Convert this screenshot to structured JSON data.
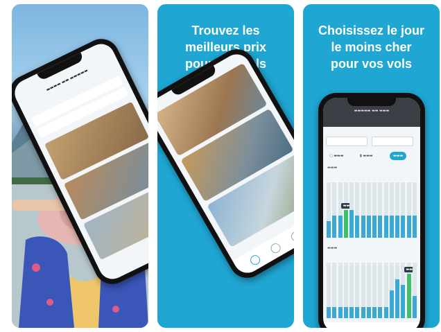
{
  "panel2": {
    "headline": [
      "Trouvez les",
      "meilleurs prix",
      "pour vos vols"
    ]
  },
  "panel3": {
    "headline": [
      "Choisissez le jour",
      "le moins cher",
      "pour vos vols"
    ]
  },
  "colors": {
    "panel_blue": "#1fa6d3",
    "bar_blue": "#3aa9d6",
    "bar_selected": "#3fbf6a",
    "phone_frame": "#111111"
  },
  "chart_data": [
    {
      "type": "bar",
      "title": "",
      "series": [
        {
          "values": [
            3,
            4,
            4,
            5,
            5,
            4,
            4,
            4,
            4,
            4,
            4,
            4,
            4,
            4,
            4,
            4
          ]
        }
      ],
      "selected_index": 3
    },
    {
      "type": "bar",
      "title": "",
      "series": [
        {
          "values": [
            2,
            2,
            2,
            2,
            2,
            2,
            2,
            2,
            2,
            2,
            2,
            5,
            7,
            6,
            8,
            4
          ]
        }
      ],
      "selected_index": 14
    }
  ]
}
